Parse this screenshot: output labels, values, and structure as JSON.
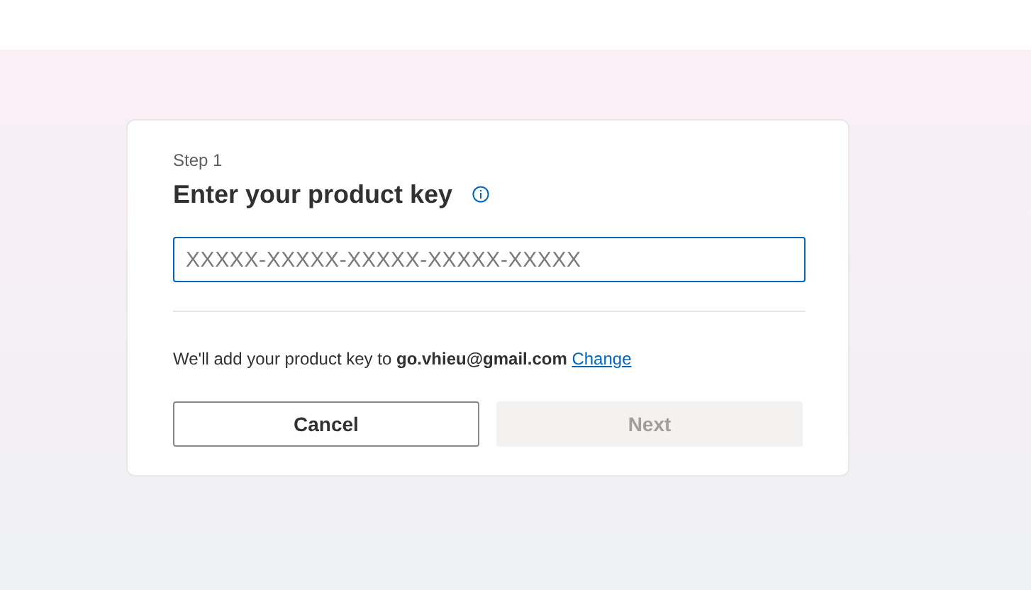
{
  "step": "Step 1",
  "title": "Enter your product key",
  "key_field": {
    "placeholder": "XXXXX-XXXXX-XXXXX-XXXXX-XXXXX"
  },
  "account_note": {
    "text": "We'll add your product key to **go.vhieu@gmail.com**",
    "link": "Change"
  },
  "buttons": [
    {
      "label": "Cancel",
      "kind": "secondary",
      "disabled": false
    },
    {
      "label": "Next",
      "kind": "primary",
      "disabled": true
    }
  ]
}
